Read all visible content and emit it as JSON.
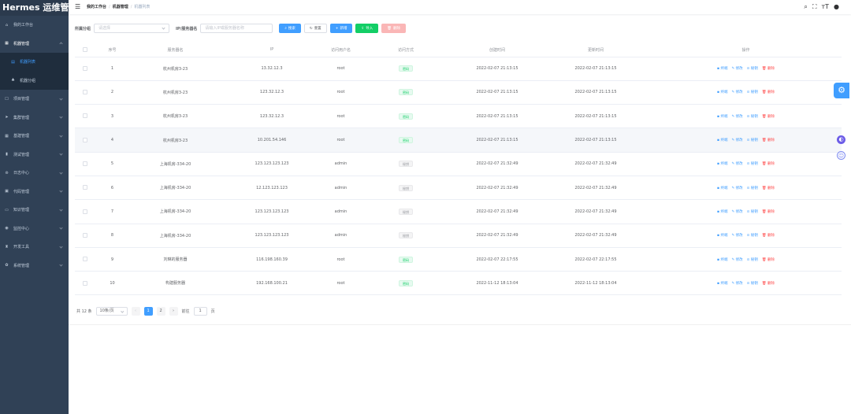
{
  "app": {
    "logo": "Hermes 运维管理"
  },
  "sidebar": {
    "items": [
      {
        "label": "我的工作台",
        "icon": "⌂",
        "icon_name": "home-icon",
        "type": "root"
      },
      {
        "label": "机器管理",
        "icon": "▦",
        "icon_name": "server-icon",
        "type": "open"
      },
      {
        "label": "机器列表",
        "icon": "▤",
        "icon_name": "list-icon",
        "type": "sub-active"
      },
      {
        "label": "机器分组",
        "icon": "♣",
        "icon_name": "tree-icon",
        "type": "sub"
      },
      {
        "label": "项目管理",
        "icon": "☐",
        "icon_name": "edit-icon",
        "type": "closed"
      },
      {
        "label": "集群管理",
        "icon": "➤",
        "icon_name": "cluster-icon",
        "type": "closed"
      },
      {
        "label": "基建管理",
        "icon": "▦",
        "icon_name": "grid-icon",
        "type": "closed"
      },
      {
        "label": "测试管理",
        "icon": "▮",
        "icon_name": "chart-icon",
        "type": "closed"
      },
      {
        "label": "日志中心",
        "icon": "⊜",
        "icon_name": "log-icon",
        "type": "closed"
      },
      {
        "label": "代码管理",
        "icon": "▣",
        "icon_name": "code-icon",
        "type": "closed"
      },
      {
        "label": "知识管理",
        "icon": "▭",
        "icon_name": "book-icon",
        "type": "closed"
      },
      {
        "label": "监控中心",
        "icon": "◉",
        "icon_name": "monitor-icon",
        "type": "closed"
      },
      {
        "label": "开发工具",
        "icon": "♜",
        "icon_name": "tool-icon",
        "type": "closed"
      },
      {
        "label": "系统管理",
        "icon": "✿",
        "icon_name": "system-icon",
        "type": "closed"
      }
    ]
  },
  "navbar": {
    "breadcrumb": [
      "我的工作台",
      "机器管理",
      "机器列表"
    ]
  },
  "search": {
    "group_label": "所属分组",
    "group_placeholder": "请选择",
    "ip_label": "IP/服务器名",
    "ip_placeholder": "请输入IP或服务器名称",
    "search_btn": "搜索",
    "reset_btn": "重置",
    "add_btn": "新增",
    "import_btn": "导入",
    "delete_btn": "删除"
  },
  "table": {
    "headers": [
      "序号",
      "服务器名",
      "IP",
      "访问用户名",
      "访问方式",
      "创建时间",
      "更新时间",
      "操作"
    ],
    "ops": [
      "终端",
      "修改",
      "秘钥",
      "删除"
    ],
    "rows": [
      {
        "idx": "1",
        "name": "杭州机房3-23",
        "ip": "13.32.12.3",
        "user": "root",
        "mode": "密码",
        "created": "2022-02-07 21:13:15",
        "updated": "2022-02-07 21:13:15"
      },
      {
        "idx": "2",
        "name": "杭州机房3-23",
        "ip": "123.32.12.3",
        "user": "root",
        "mode": "密码",
        "created": "2022-02-07 21:13:15",
        "updated": "2022-02-07 21:13:15"
      },
      {
        "idx": "3",
        "name": "杭州机房3-23",
        "ip": "123.32.12.3",
        "user": "root",
        "mode": "密码",
        "created": "2022-02-07 21:13:15",
        "updated": "2022-02-07 21:13:15"
      },
      {
        "idx": "4",
        "name": "杭州机房3-23",
        "ip": "10.201.54.146",
        "user": "root",
        "mode": "密码",
        "created": "2022-02-07 21:13:15",
        "updated": "2022-02-07 21:13:15"
      },
      {
        "idx": "5",
        "name": "上海机房-334-20",
        "ip": "123.123.123.123",
        "user": "admin",
        "mode": "秘钥",
        "created": "2022-02-07 21:32:49",
        "updated": "2022-02-07 21:32:49"
      },
      {
        "idx": "6",
        "name": "上海机房-334-20",
        "ip": "12.123.123.123",
        "user": "admin",
        "mode": "秘钥",
        "created": "2022-02-07 21:32:49",
        "updated": "2022-02-07 21:32:49"
      },
      {
        "idx": "7",
        "name": "上海机房-334-20",
        "ip": "123.123.123.123",
        "user": "admin",
        "mode": "秘钥",
        "created": "2022-02-07 21:32:49",
        "updated": "2022-02-07 21:32:49"
      },
      {
        "idx": "8",
        "name": "上海机房-334-20",
        "ip": "123.123.123.123",
        "user": "admin",
        "mode": "秘钥",
        "created": "2022-02-07 21:32:49",
        "updated": "2022-02-07 21:32:49"
      },
      {
        "idx": "9",
        "name": "刘琳的服务器",
        "ip": "116.198.160.39",
        "user": "root",
        "mode": "密码",
        "created": "2022-02-07 22:17:55",
        "updated": "2022-02-07 22:17:55"
      },
      {
        "idx": "10",
        "name": "构建服务器",
        "ip": "192.168.100.21",
        "user": "root",
        "mode": "密码",
        "created": "2022-11-12 18:13:04",
        "updated": "2022-11-12 18:13:04"
      }
    ]
  },
  "pagination": {
    "total": "共 12 条",
    "page_size": "10条/页",
    "pages": [
      "1",
      "2"
    ],
    "goto_label": "前往",
    "goto_value": "1",
    "goto_suffix": "页"
  },
  "colors": {
    "primary": "#409eff",
    "success": "#13ce66",
    "danger": "#ff4949",
    "sidebar": "#304156"
  }
}
